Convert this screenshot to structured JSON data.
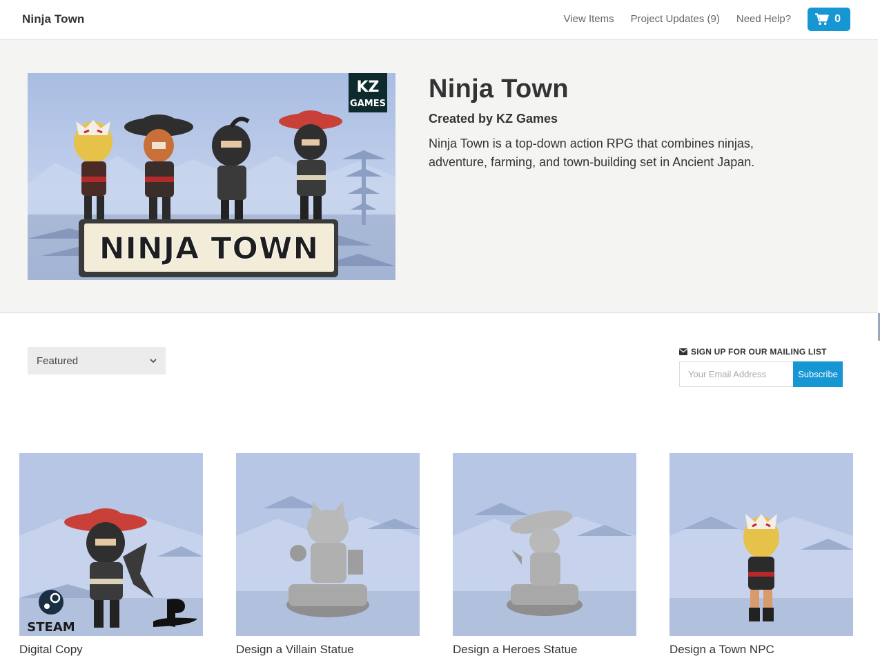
{
  "nav": {
    "brand": "Ninja Town",
    "links": [
      "View Items",
      "Project Updates (9)",
      "Need Help?"
    ],
    "cart_count": "0"
  },
  "hero": {
    "title": "Ninja Town",
    "creator": "Created by KZ Games",
    "description": "Ninja Town is a top-down action RPG that combines ninjas, adventure, farming, and town-building set in Ancient Japan.",
    "banner_logo_line1": "KZ",
    "banner_logo_line2": "GAMES",
    "banner_title": "NINJA TOWN"
  },
  "sort": {
    "selected": "Featured"
  },
  "mailing": {
    "title": "SIGN UP FOR OUR MAILING LIST",
    "placeholder": "Your Email Address",
    "button": "Subscribe"
  },
  "items": [
    {
      "label": "Digital Copy",
      "badge_text": "STEAM"
    },
    {
      "label": "Design a Villain Statue"
    },
    {
      "label": "Design a Heroes Statue"
    },
    {
      "label": "Design a Town NPC"
    }
  ],
  "colors": {
    "accent": "#1796d4",
    "hero_bg": "#f4f5f3",
    "sky": "#b6c6e4"
  }
}
